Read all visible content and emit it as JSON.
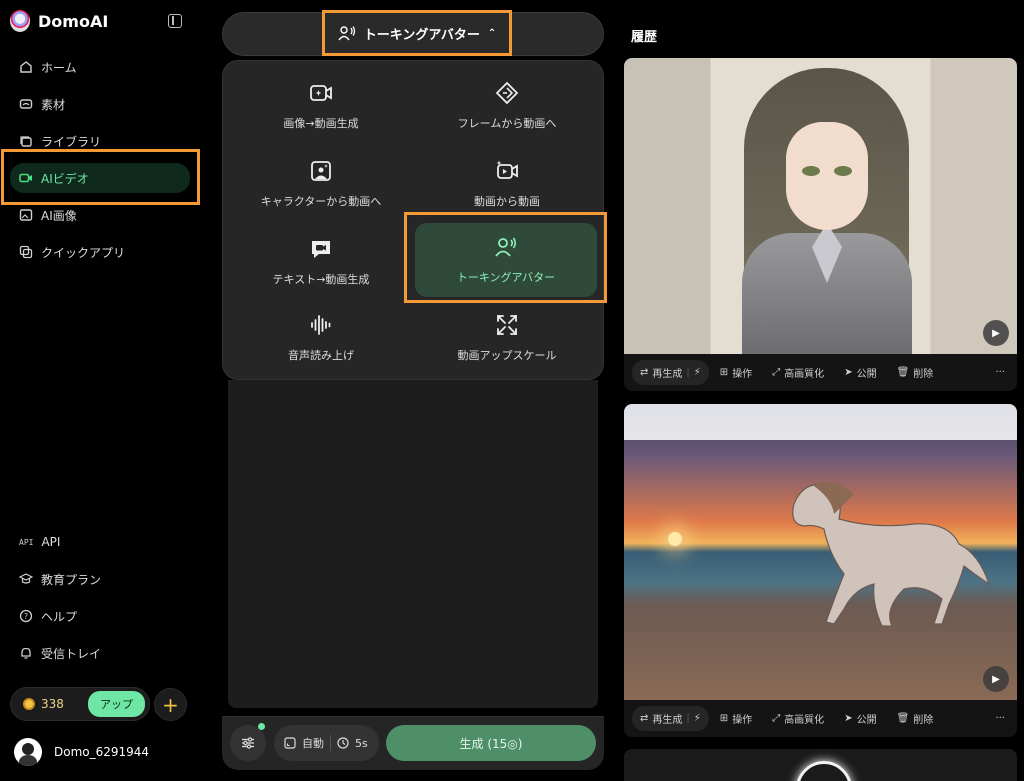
{
  "app": {
    "name": "DomoAI"
  },
  "sidebar": {
    "items": [
      {
        "label": "ホーム",
        "icon": "home-icon"
      },
      {
        "label": "素材",
        "icon": "assets-icon"
      },
      {
        "label": "ライブラリ",
        "icon": "library-icon"
      },
      {
        "label": "AIビデオ",
        "icon": "video-icon",
        "active": true
      },
      {
        "label": "AI画像",
        "icon": "image-icon"
      },
      {
        "label": "クイックアプリ",
        "icon": "quick-app-icon"
      }
    ],
    "bottom_items": [
      {
        "label": "API",
        "icon_text": "API"
      },
      {
        "label": "教育プラン",
        "icon": "graduation-icon"
      },
      {
        "label": "ヘルプ",
        "icon": "help-icon"
      },
      {
        "label": "受信トレイ",
        "icon": "bell-icon"
      }
    ],
    "credits": "338",
    "upgrade_label": "アップ",
    "user_name": "Domo_6291944"
  },
  "mode": {
    "selected": "トーキングアバター",
    "options": [
      {
        "label": "画像→動画生成",
        "icon": "image-to-video-icon"
      },
      {
        "label": "フレームから動画へ",
        "icon": "frame-to-video-icon"
      },
      {
        "label": "キャラクターから動画へ",
        "icon": "character-to-video-icon"
      },
      {
        "label": "動画から動画",
        "icon": "video-to-video-icon"
      },
      {
        "label": "テキスト→動画生成",
        "icon": "text-to-video-icon"
      },
      {
        "label": "トーキングアバター",
        "icon": "talking-avatar-icon",
        "selected": true
      },
      {
        "label": "音声読み上げ",
        "icon": "voice-waveform-icon"
      },
      {
        "label": "動画アップスケール",
        "icon": "upscale-icon"
      }
    ]
  },
  "bottom_bar": {
    "aspect_label": "自動",
    "duration_label": "5s",
    "generate_label": "生成 (15◎)"
  },
  "history": {
    "title": "履歴",
    "toolbar": {
      "regenerate": "再生成",
      "operate": "操作",
      "enhance": "高画質化",
      "publish": "公開",
      "delete": "削除",
      "more": "···"
    }
  },
  "colors": {
    "accent_green": "#6ee7a4",
    "highlight_orange": "#f39a36",
    "generate_button": "#4f8f68"
  }
}
